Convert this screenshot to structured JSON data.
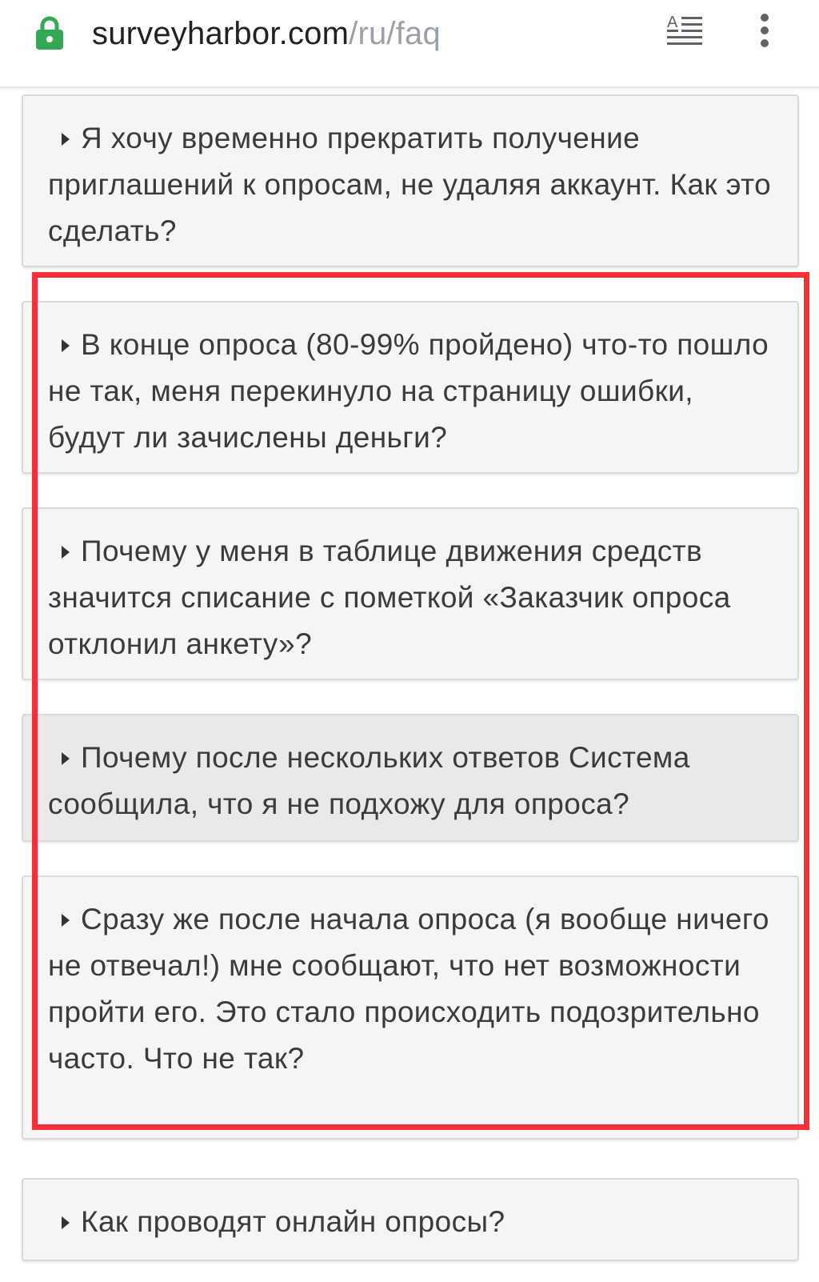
{
  "browser": {
    "url_host": "surveyharbor.com",
    "url_path": "/ru/faq",
    "icons": {
      "lock": "lock-icon",
      "reader": "reader-mode-icon",
      "menu": "more-vert-icon"
    },
    "colors": {
      "lock": "#34a853",
      "highlight": "#ff2d38"
    }
  },
  "faq": {
    "items": [
      {
        "question": "Я хочу временно прекратить получение приглашений к опросам, не удаляя аккаунт. Как это сделать?"
      },
      {
        "question": "В конце опроса (80-99% пройдено) что-то пошло не так, меня перекинуло на страницу ошибки, будут ли зачислены деньги?"
      },
      {
        "question": "Почему у меня в таблице движения средств значится списание с пометкой «Заказчик опроса отклонил анкету»?"
      },
      {
        "question": "Почему после нескольких ответов Система сообщила, что я не подхожу для опроса?"
      },
      {
        "question": "Сразу же после начала опроса (я вообще ничего не отвечал!) мне сообщают, что нет возможности пройти его. Это стало происходить подозрительно часто. Что не так?"
      },
      {
        "question": "Как проводят онлайн опросы?"
      }
    ]
  }
}
